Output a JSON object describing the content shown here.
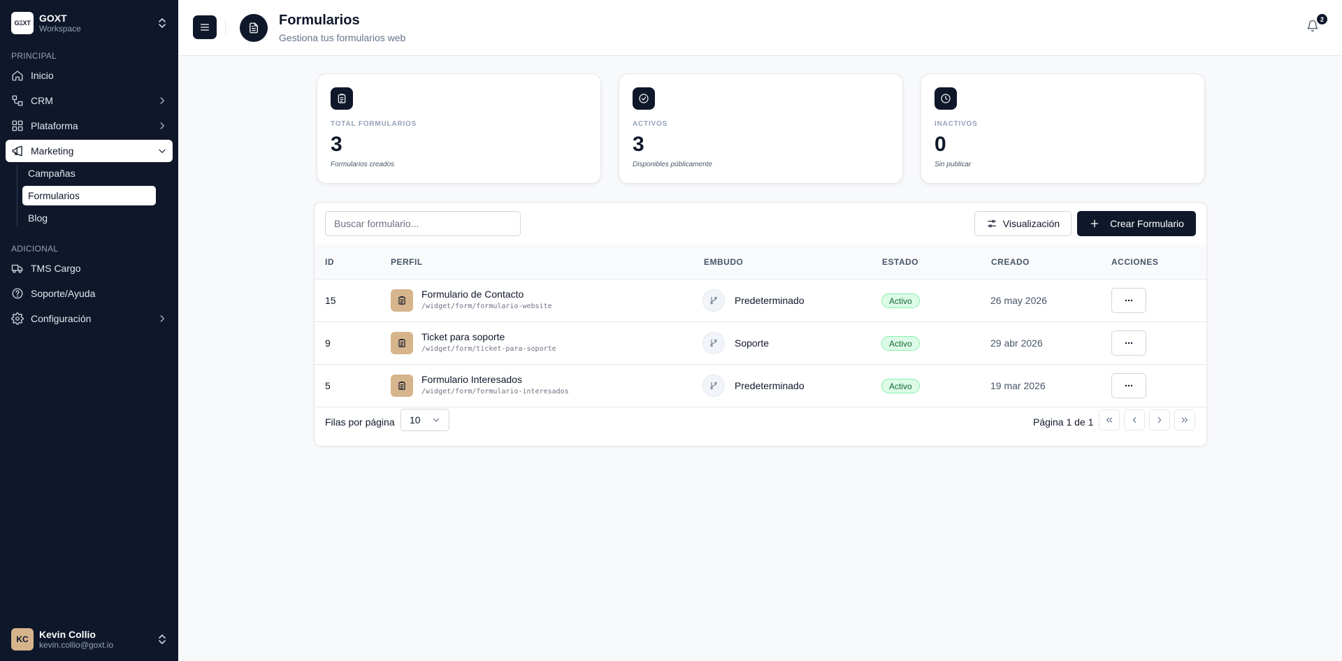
{
  "workspace": {
    "logo_text": "GΞXT",
    "name": "GOXT",
    "subtitle": "Workspace"
  },
  "sidebar": {
    "section_principal": "PRINCIPAL",
    "section_adicional": "ADICIONAL",
    "items": [
      {
        "label": "Inicio",
        "icon": "home-icon"
      },
      {
        "label": "CRM",
        "icon": "crm-icon"
      },
      {
        "label": "Plataforma",
        "icon": "grid-icon"
      },
      {
        "label": "Marketing",
        "icon": "megaphone-icon"
      }
    ],
    "marketing_sub": [
      {
        "label": "Campañas"
      },
      {
        "label": "Formularios"
      },
      {
        "label": "Blog"
      }
    ],
    "extra_items": [
      {
        "label": "TMS Cargo",
        "icon": "truck-icon"
      },
      {
        "label": "Soporte/Ayuda",
        "icon": "help-icon"
      },
      {
        "label": "Configuración",
        "icon": "gear-icon"
      }
    ]
  },
  "user": {
    "initials": "KC",
    "name": "Kevin Collio",
    "email": "kevin.collio@goxt.io"
  },
  "header": {
    "title": "Formularios",
    "subtitle": "Gestiona tus formularios web",
    "notification_count": "2"
  },
  "stats": [
    {
      "label": "TOTAL FORMULARIOS",
      "value": "3",
      "desc": "Formularios creados"
    },
    {
      "label": "ACTIVOS",
      "value": "3",
      "desc": "Disponibles públicamente"
    },
    {
      "label": "INACTIVOS",
      "value": "0",
      "desc": "Sin publicar"
    }
  ],
  "toolbar": {
    "search_placeholder": "Buscar formulario...",
    "view_label": "Visualización",
    "create_label": "Crear Formulario"
  },
  "table": {
    "headers": {
      "id": "ID",
      "perfil": "PERFIL",
      "embudo": "EMBUDO",
      "estado": "ESTADO",
      "creado": "CREADO",
      "acciones": "ACCIONES"
    },
    "rows": [
      {
        "id": "15",
        "name": "Formulario de Contacto",
        "path": "/widget/form/formulario-website",
        "funnel": "Predeterminado",
        "status": "Activo",
        "created": "26 may 2026"
      },
      {
        "id": "9",
        "name": "Ticket para soporte",
        "path": "/widget/form/ticket-para-soporte",
        "funnel": "Soporte",
        "status": "Activo",
        "created": "29 abr 2026"
      },
      {
        "id": "5",
        "name": "Formulario Interesados",
        "path": "/widget/form/formulario-interesados",
        "funnel": "Predeterminado",
        "status": "Activo",
        "created": "19 mar 2026"
      }
    ]
  },
  "pagination": {
    "rows_label": "Filas por página",
    "rows_value": "10",
    "page_info": "Página 1 de 1"
  },
  "colors": {
    "sidebar_bg": "#0f172a",
    "accent": "#0f172a",
    "form_icon_bg": "#d6b48c",
    "active_badge_bg": "#dcfce7",
    "active_badge_text": "#166534"
  }
}
